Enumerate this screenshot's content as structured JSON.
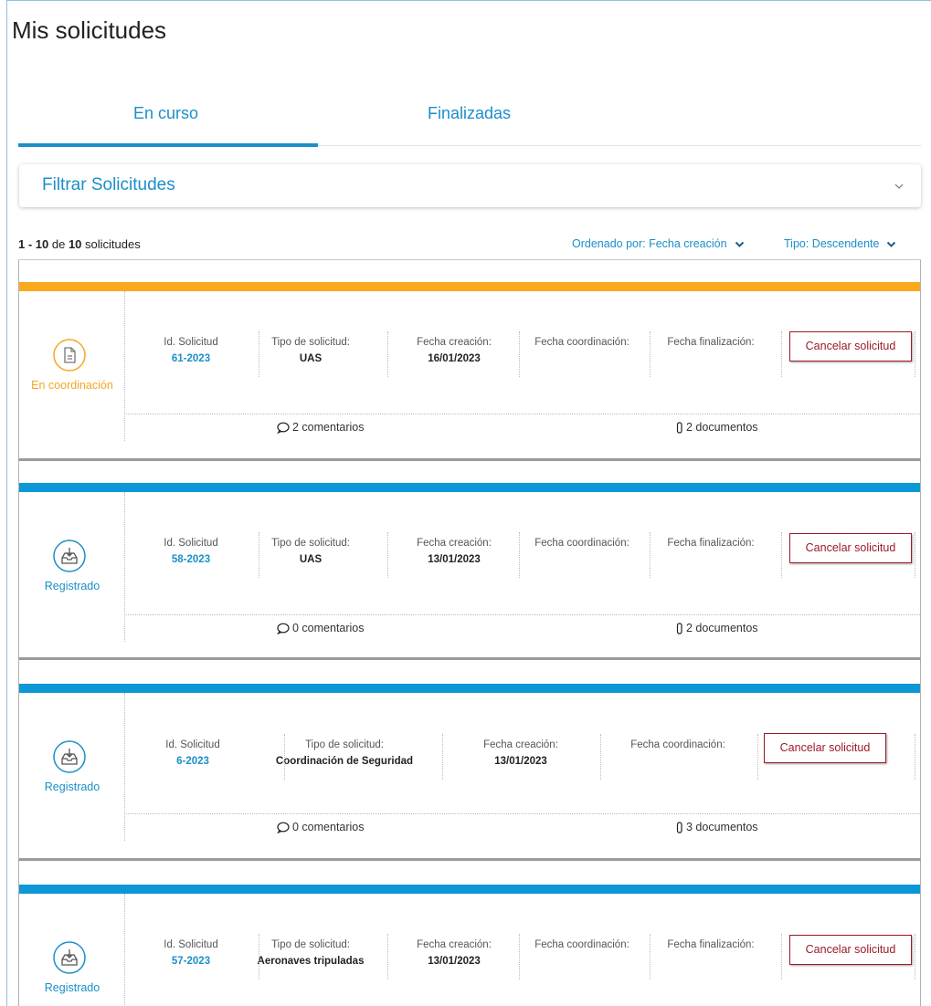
{
  "page": {
    "title": "Mis solicitudes"
  },
  "tabs": [
    {
      "label": "En curso",
      "active": true
    },
    {
      "label": "Finalizadas",
      "active": false
    }
  ],
  "filter": {
    "title": "Filtrar Solicitudes"
  },
  "summary": {
    "from": "1",
    "sep": " - ",
    "to": "10",
    "de": " de ",
    "total": "10",
    "suffix": " solicitudes"
  },
  "sort": {
    "order_label": "Ordenado por: Fecha creación",
    "type_label": "Tipo: Descendente"
  },
  "colors": {
    "accent": "#1b8fc8",
    "coordination": "#f5a623",
    "danger": "#9b1b2a"
  },
  "cards": [
    {
      "status": "En coordinación",
      "status_icon": "document-icon",
      "bar_color": "#f9a91b",
      "fields": [
        {
          "label": "Id. Solicitud",
          "value": "61-2023"
        },
        {
          "label": "Tipo de solicitud:",
          "value": "UAS"
        },
        {
          "label": "Fecha creación:",
          "value": "16/01/2023"
        },
        {
          "label": "Fecha coordinación:",
          "value": ""
        },
        {
          "label": "Fecha finalización:",
          "value": ""
        }
      ],
      "cancel": "Cancelar solicitud",
      "comments": "2 comentarios",
      "documents": "2 documentos"
    },
    {
      "status": "Registrado",
      "status_icon": "inbox-icon",
      "bar_color": "#0c97d6",
      "fields": [
        {
          "label": "Id. Solicitud",
          "value": "58-2023"
        },
        {
          "label": "Tipo de solicitud:",
          "value": "UAS"
        },
        {
          "label": "Fecha creación:",
          "value": "13/01/2023"
        },
        {
          "label": "Fecha coordinación:",
          "value": ""
        },
        {
          "label": "Fecha finalización:",
          "value": ""
        }
      ],
      "cancel": "Cancelar solicitud",
      "comments": "0 comentarios",
      "documents": "2 documentos"
    },
    {
      "status": "Registrado",
      "status_icon": "inbox-icon",
      "bar_color": "#0c97d6",
      "fields": [
        {
          "label": "Id. Solicitud",
          "value": "6-2023"
        },
        {
          "label": "Tipo de solicitud:",
          "value": "Coordinación de Seguridad"
        },
        {
          "label": "Fecha creación:",
          "value": "13/01/2023"
        },
        {
          "label": "Fecha coordinación:",
          "value": ""
        }
      ],
      "cancel": "Cancelar solicitud",
      "comments": "0 comentarios",
      "documents": "3 documentos"
    },
    {
      "status": "Registrado",
      "status_icon": "inbox-icon",
      "bar_color": "#0c97d6",
      "fields": [
        {
          "label": "Id. Solicitud",
          "value": "57-2023"
        },
        {
          "label": "Tipo de solicitud:",
          "value": "Aeronaves tripuladas"
        },
        {
          "label": "Fecha creación:",
          "value": "13/01/2023"
        },
        {
          "label": "Fecha coordinación:",
          "value": ""
        },
        {
          "label": "Fecha finalización:",
          "value": ""
        }
      ],
      "cancel": "Cancelar solicitud",
      "comments": "",
      "documents": ""
    }
  ]
}
